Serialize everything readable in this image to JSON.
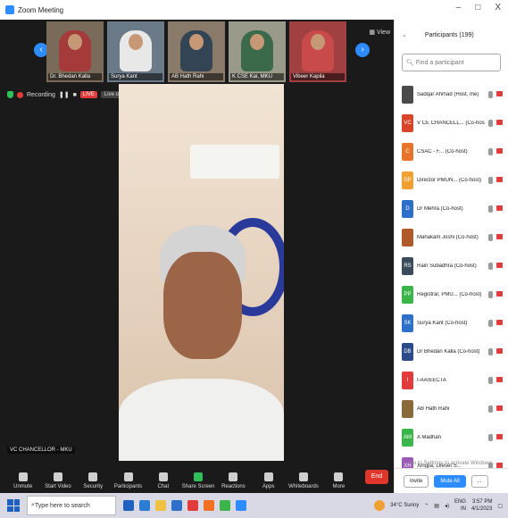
{
  "window": {
    "title": "Zoom Meeting",
    "controls": [
      "–",
      "□",
      "X"
    ]
  },
  "thumbnails": [
    {
      "name": "Dr. Bhedan Kalla",
      "bg": "#7a6a5a",
      "shirt": "#a43a3a"
    },
    {
      "name": "Surya Kant",
      "bg": "#6b7a88",
      "shirt": "#e8e8e8"
    },
    {
      "name": "AB Hath Rahi",
      "bg": "#8a7a6a",
      "shirt": "#334455"
    },
    {
      "name": "K CSE Kai, MKU",
      "bg": "#9a9a8a",
      "shirt": "#3a6a4a"
    },
    {
      "name": "Vibeer Kapila",
      "bg": "#a04040",
      "shirt": "#c94a4a"
    }
  ],
  "stage": {
    "view_label": "View",
    "recording_label": "Recording",
    "live_label": "LIVE",
    "live_on_label": "Live on",
    "speaker_name": "VC CHANCELLOR - MKU"
  },
  "toolbar": {
    "items": [
      {
        "label": "Unmute",
        "icon": "mic-icon"
      },
      {
        "label": "Start Video",
        "icon": "video-icon"
      },
      {
        "label": "Security",
        "icon": "shield-icon"
      },
      {
        "label": "Participants",
        "icon": "participants-icon",
        "count": "199"
      },
      {
        "label": "Chat",
        "icon": "chat-icon"
      },
      {
        "label": "Share Screen",
        "icon": "share-icon"
      },
      {
        "label": "Reactions",
        "icon": "reactions-icon"
      },
      {
        "label": "Apps",
        "icon": "apps-icon"
      },
      {
        "label": "Whiteboards",
        "icon": "whiteboard-icon"
      },
      {
        "label": "More",
        "icon": "more-icon"
      }
    ],
    "end_label": "End"
  },
  "participants": {
    "title": "Participants (199)",
    "search_placeholder": "Find a participant",
    "list": [
      {
        "initials": "",
        "name": "Sadqar Ahmad (Host, me)",
        "color": "#4a4a4a"
      },
      {
        "initials": "VC",
        "name": "V CE CHANCELL... (Co-host)",
        "color": "#d9442b"
      },
      {
        "initials": "C",
        "name": "CSAC - F... (Co-host)",
        "color": "#e8742b"
      },
      {
        "initials": "DP",
        "name": "Director PMUN... (Co-host)",
        "color": "#f0a030"
      },
      {
        "initials": "D",
        "name": "Dr Mehra (Co-host)",
        "color": "#2d6fc9"
      },
      {
        "initials": "",
        "name": "Mahakam Joshi (Co-host)",
        "color": "#b05a2a"
      },
      {
        "initials": "RS",
        "name": "Rain Subadhra (Co-host)",
        "color": "#394a5a"
      },
      {
        "initials": "PP",
        "name": "Registrar, PMU... (Co-host)",
        "color": "#3bb54a"
      },
      {
        "initials": "SK",
        "name": "Surya Kant (Co-host)",
        "color": "#2d6fc9"
      },
      {
        "initials": "DB",
        "name": "Dr Bhedan Kalla (Co-host)",
        "color": "#2a4a8a"
      },
      {
        "initials": "I",
        "name": "I-AA/EECTA",
        "color": "#e23b3b"
      },
      {
        "initials": "",
        "name": "AB Hath Rahi",
        "color": "#8a6a3a"
      },
      {
        "initials": "AM",
        "name": "A Madhan",
        "color": "#3bb54a"
      },
      {
        "initials": "XH",
        "name": "Xingjia, Lifeset S...",
        "color": "#9b59b6"
      }
    ],
    "activate_text": "Go to Settings to activate Windows.",
    "invite_label": "Invite",
    "mute_all_label": "Mute All",
    "more_label": "..."
  },
  "taskbar": {
    "search_placeholder": "Type here to search",
    "weather": "34°C Sunny",
    "language": "ENG",
    "region": "IN",
    "time": "3:57 PM",
    "date": "4/1/2023"
  }
}
